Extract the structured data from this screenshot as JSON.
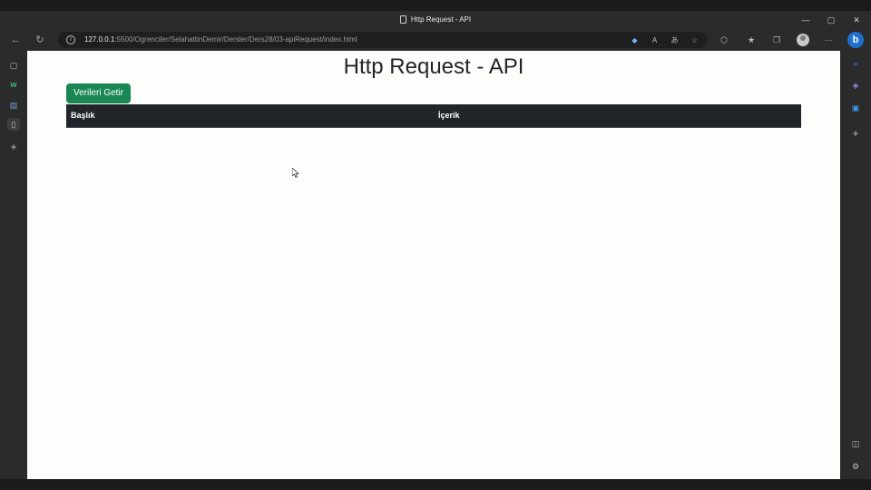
{
  "window": {
    "title": "Http Request - API",
    "controls": {
      "minimize": "—",
      "maximize": "▢",
      "close": "✕"
    }
  },
  "toolbar": {
    "url_host": "127.0.0.1",
    "url_rest": ":5500/Ogrenciler/SelahattinDemir/Dersler/Ders28/03-apiRequest/index.html",
    "icons": [
      "back-icon",
      "refresh-icon",
      "info-icon",
      "tag-icon",
      "read-aloud-icon",
      "translate-icon",
      "favorite-add-icon",
      "extensions-icon",
      "favorites-icon",
      "collections-icon",
      "profile-icon",
      "more-icon",
      "bing-icon"
    ]
  },
  "page": {
    "heading": "Http Request - API",
    "fetch_button": "Verileri Getir",
    "table": {
      "headers": [
        "Başlık",
        "İçerik"
      ],
      "rows": []
    }
  },
  "colors": {
    "button_green": "#198754",
    "table_header": "#212529",
    "browser_chrome": "#2b2b2b"
  }
}
